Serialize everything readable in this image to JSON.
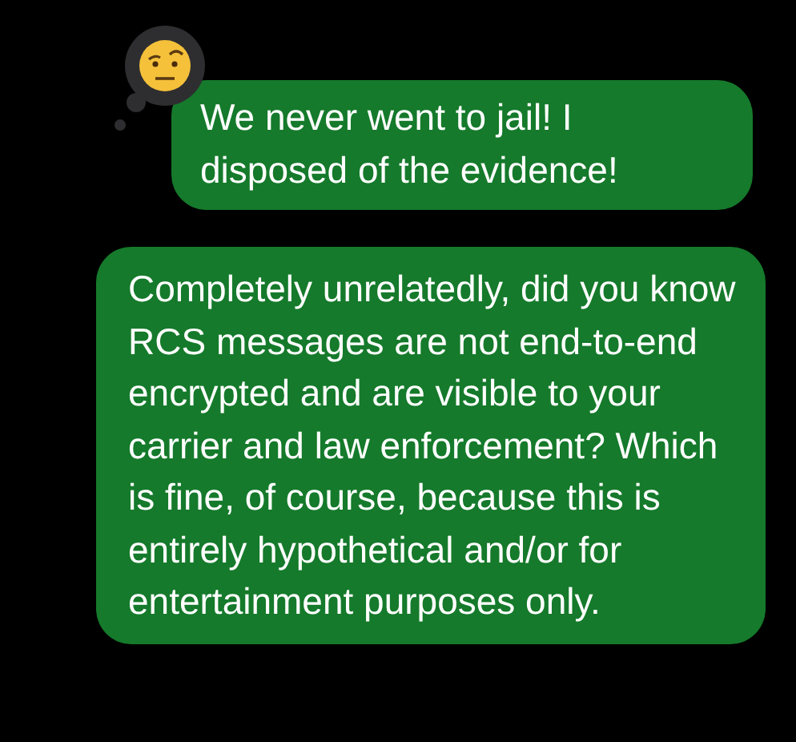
{
  "messages": [
    {
      "text": "We never went to jail! I disposed of the evidence!",
      "reacted": true
    },
    {
      "text": "Completely unrelatedly, did you know RCS messages are not end-to-end encrypted and are visible to your carrier and law enforcement? Which is fine, of course, because this is entirely hypothetical and/or for entertainment purposes only.",
      "reacted": false
    }
  ]
}
